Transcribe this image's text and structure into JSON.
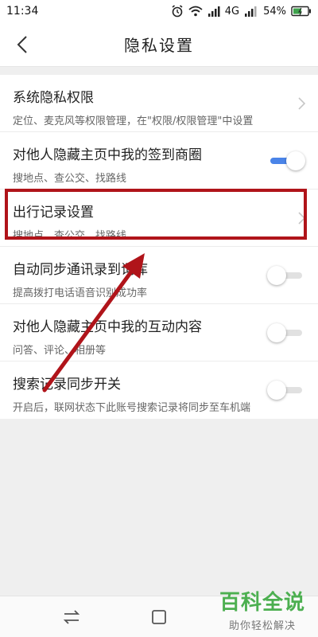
{
  "status_bar": {
    "time": "11:34",
    "network": "4G",
    "battery": "54%"
  },
  "header": {
    "title": "隐私设置",
    "back_icon": "chevron-left-icon"
  },
  "settings": [
    {
      "title": "系统隐私权限",
      "subtitle": "定位、麦克风等权限管理，在\"权限/权限管理\"中设置",
      "control": "chevron"
    },
    {
      "title": "对他人隐藏主页中我的签到商圈",
      "subtitle": "搜地点、查公交、找路线",
      "control": "toggle",
      "toggle_on": true
    },
    {
      "title": "出行记录设置",
      "subtitle": "搜地点、查公交、找路线",
      "control": "chevron"
    },
    {
      "title": "自动同步通讯录到词库",
      "subtitle": "提高拨打电话语音识别成功率",
      "control": "toggle",
      "toggle_on": false
    },
    {
      "title": "对他人隐藏主页中我的互动内容",
      "subtitle": "问答、评论、相册等",
      "control": "toggle",
      "toggle_on": false
    },
    {
      "title": "搜索记录同步开关",
      "subtitle": "开启后，联网状态下此账号搜索记录将同步至车机端",
      "control": "toggle",
      "toggle_on": false
    }
  ],
  "watermark": {
    "main": "百科全说",
    "sub": "助你轻松解决"
  },
  "colors": {
    "accent": "#4a84e8",
    "highlight": "#b0141a",
    "watermark": "#4caf50"
  }
}
